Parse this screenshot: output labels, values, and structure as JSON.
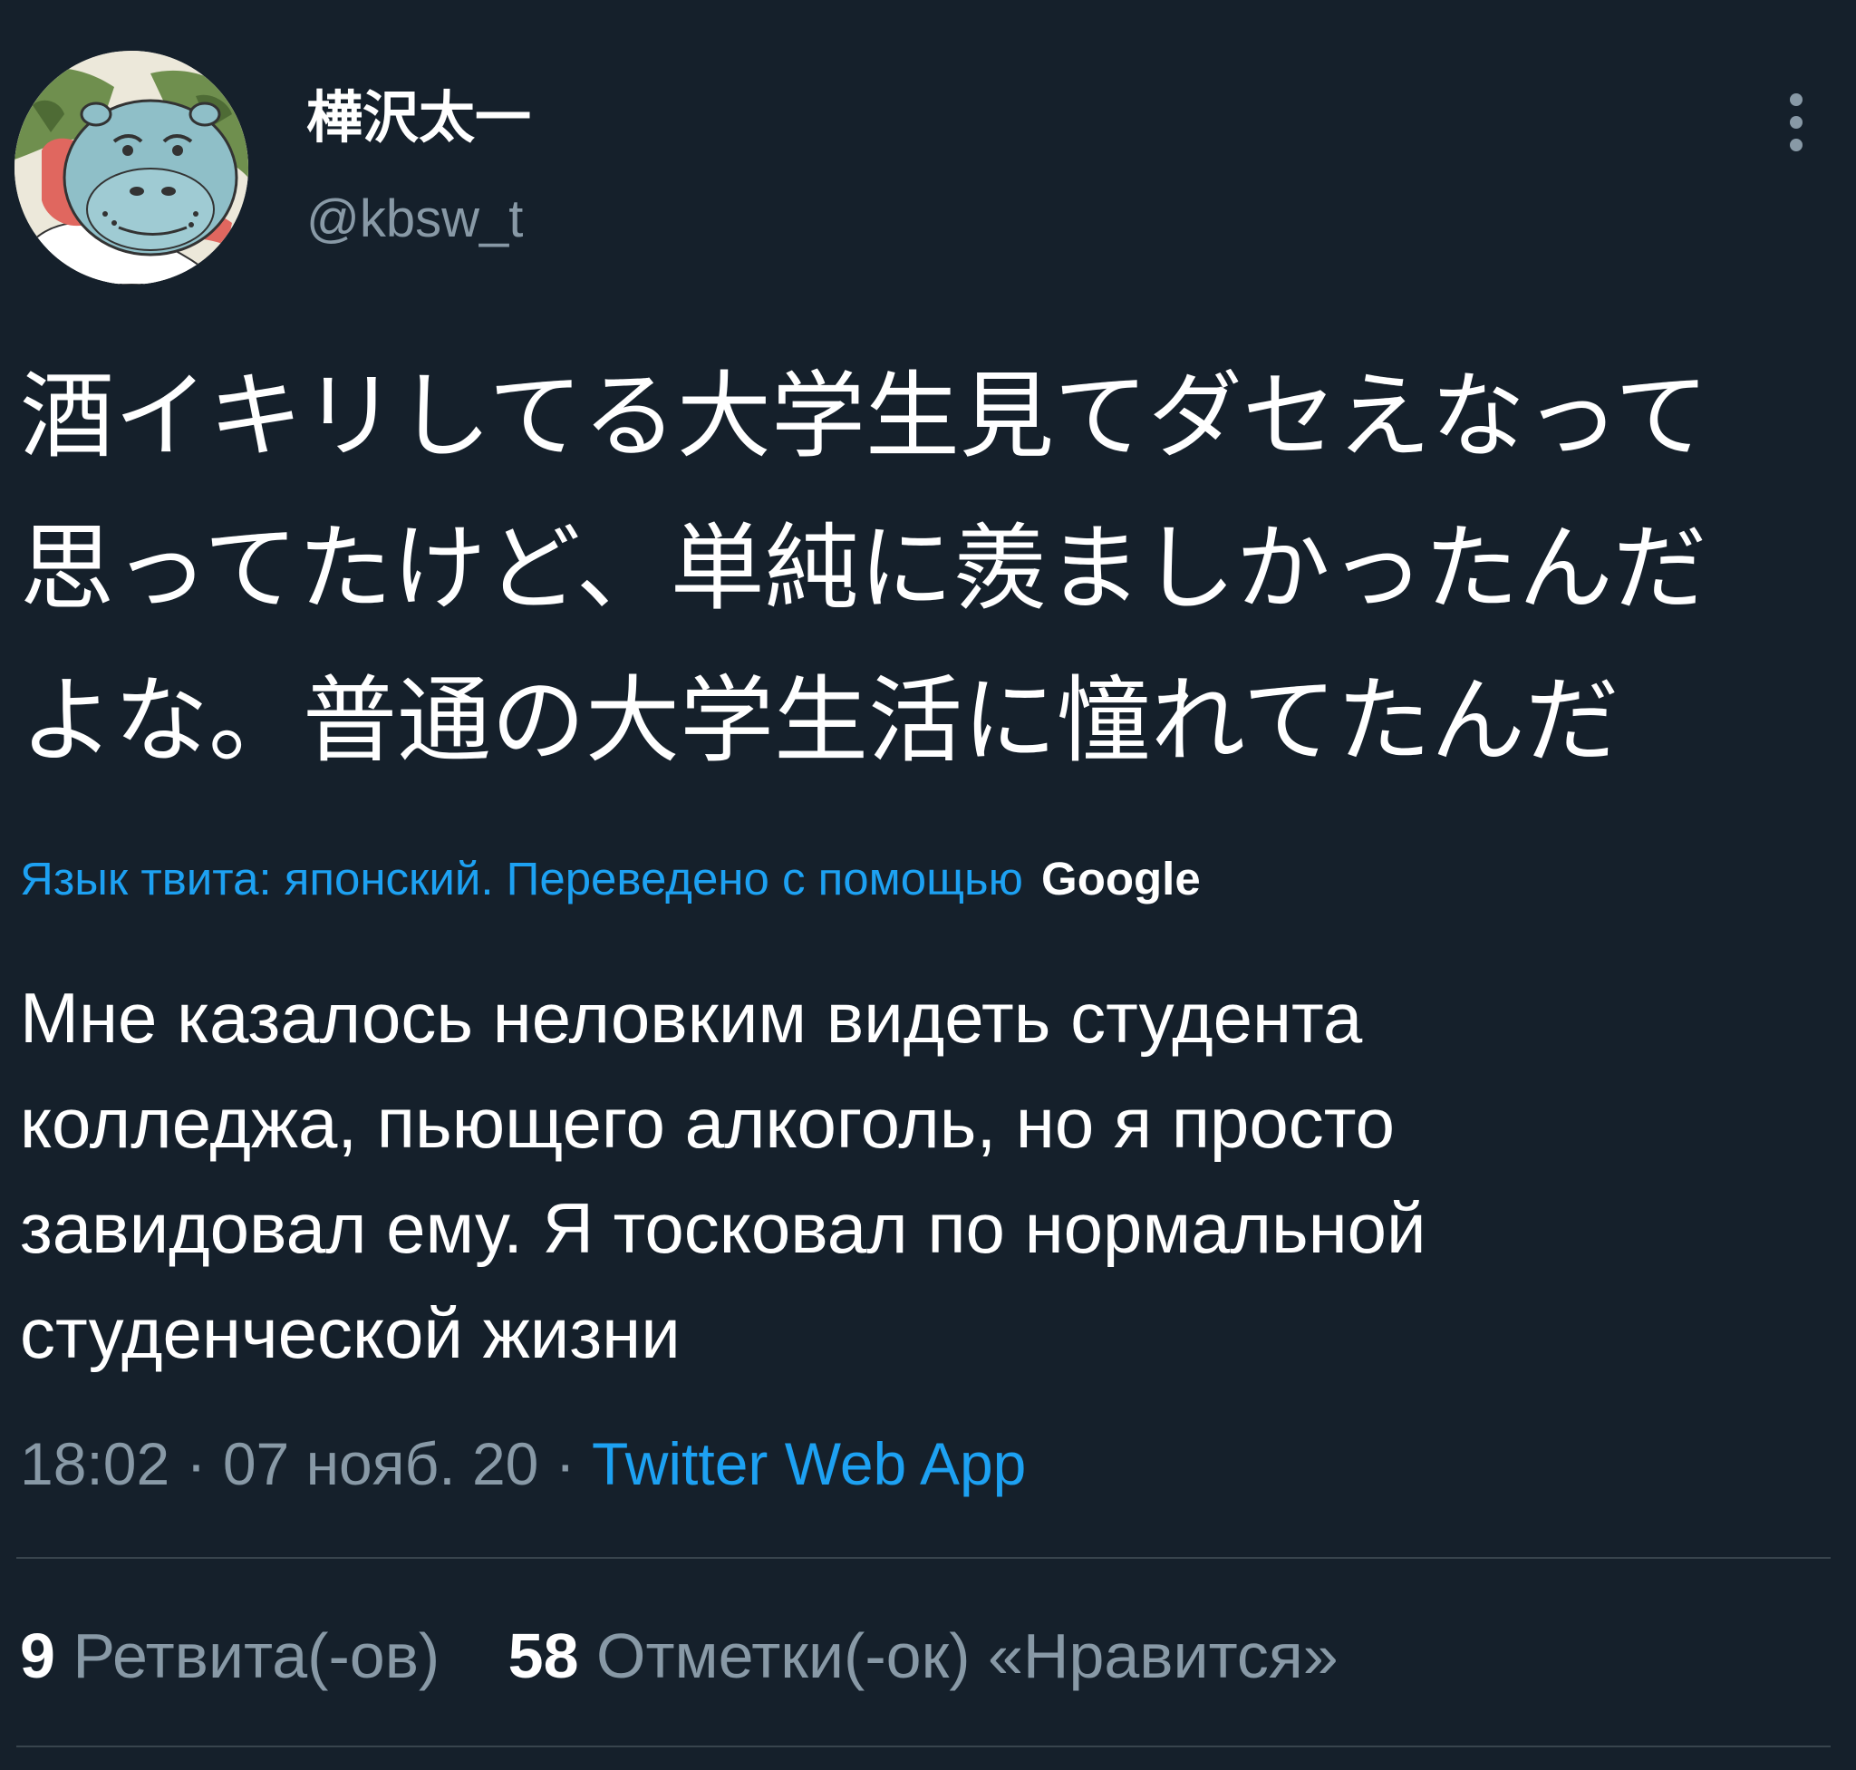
{
  "user": {
    "display_name": "樺沢太一",
    "handle": "@kbsw_t"
  },
  "icons": {
    "avatar": "hippo-avatar",
    "more": "more-vertical-icon"
  },
  "tweet": {
    "text": "酒イキリしてる大学生見てダセえなって\n思ってたけど、単純に羨ましかったんだ\nよな。普通の大学生活に憧れてたんだ"
  },
  "translation": {
    "label": "Язык твита: японский. Переведено с помощью",
    "provider": "Google",
    "text": "Мне казалось неловким видеть студента\nколледжа, пьющего алкоголь, но я просто\nзавидовал ему. Я тосковал по нормальной\nстуденческой жизни"
  },
  "meta": {
    "time": "18:02",
    "separator": "·",
    "date": "07 нояб. 20",
    "source": "Twitter Web App"
  },
  "stats": {
    "retweets_count": "9",
    "retweets_label": "Ретвита(-ов)",
    "likes_count": "58",
    "likes_label": "Отметки(-ок) «Нравится»"
  },
  "colors": {
    "background": "#15202b",
    "link": "#1da1f2",
    "secondary_text": "#8899a6",
    "divider": "#38444d"
  }
}
